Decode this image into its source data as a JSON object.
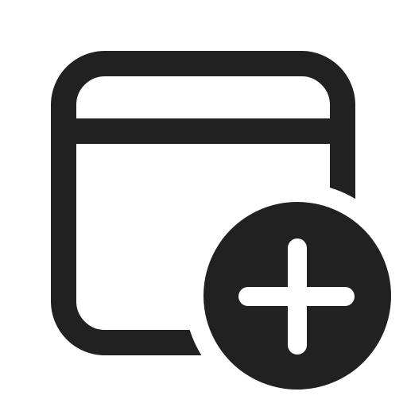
{
  "icon": {
    "name": "calendar-add-icon",
    "components": [
      "window-frame-icon",
      "add-circle-icon",
      "plus-icon"
    ]
  },
  "colors": {
    "background": "#ffffff",
    "stroke": "#212121",
    "plus": "#ffffff"
  }
}
